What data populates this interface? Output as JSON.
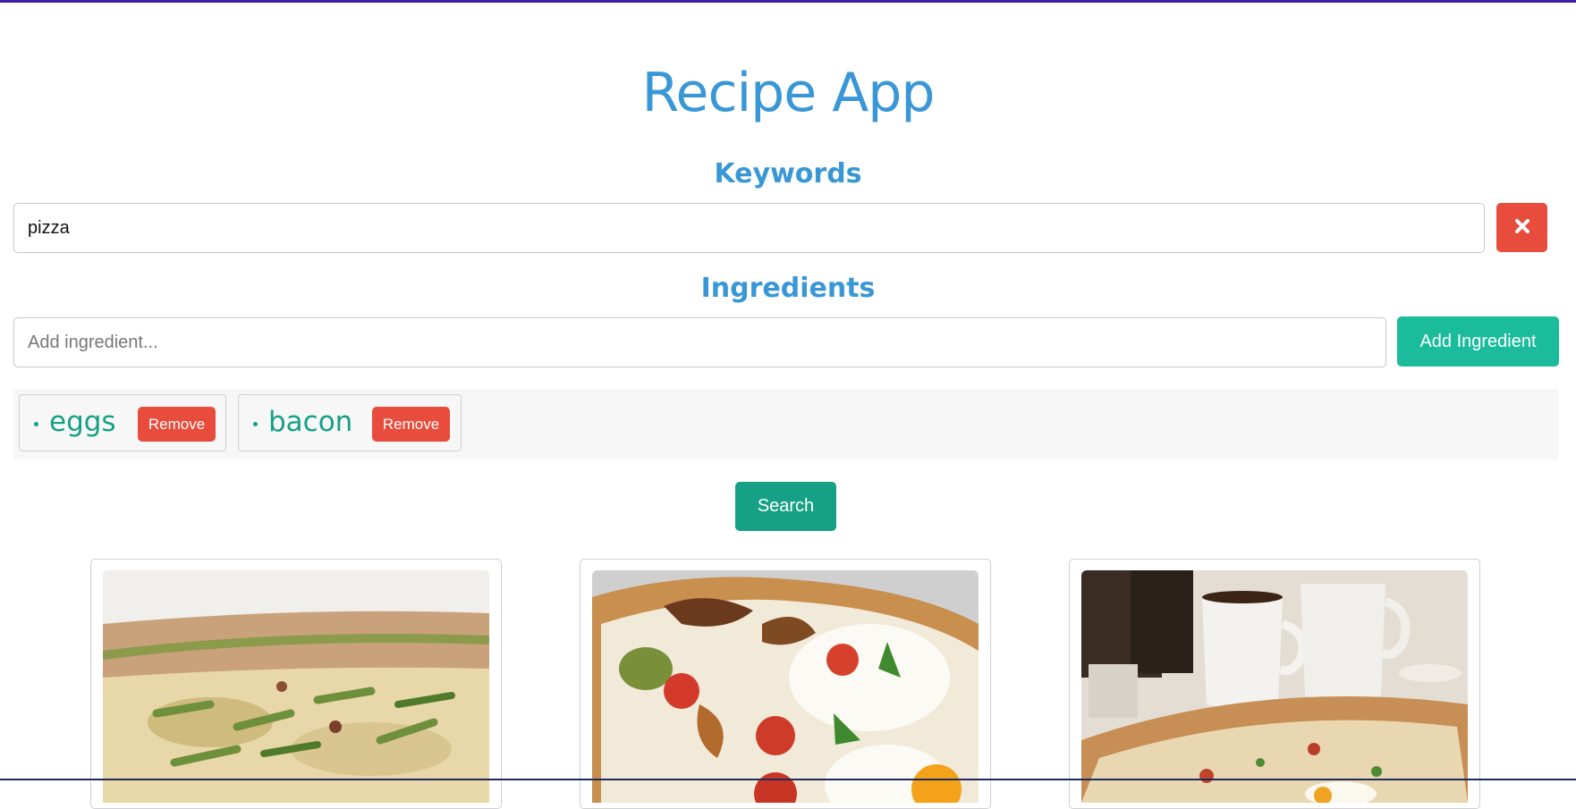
{
  "header": {
    "title": "Recipe App"
  },
  "keywords": {
    "label": "Keywords",
    "value": "pizza",
    "clear_icon": "close-icon"
  },
  "ingredients": {
    "label": "Ingredients",
    "placeholder": "Add ingredient...",
    "add_label": "Add Ingredient",
    "items": [
      {
        "name": "eggs",
        "remove_label": "Remove"
      },
      {
        "name": "bacon",
        "remove_label": "Remove"
      }
    ]
  },
  "search": {
    "label": "Search"
  },
  "colors": {
    "title": "#3a97d6",
    "danger": "#e74c3c",
    "success": "#1abc9c",
    "success_dark": "#16a085"
  }
}
